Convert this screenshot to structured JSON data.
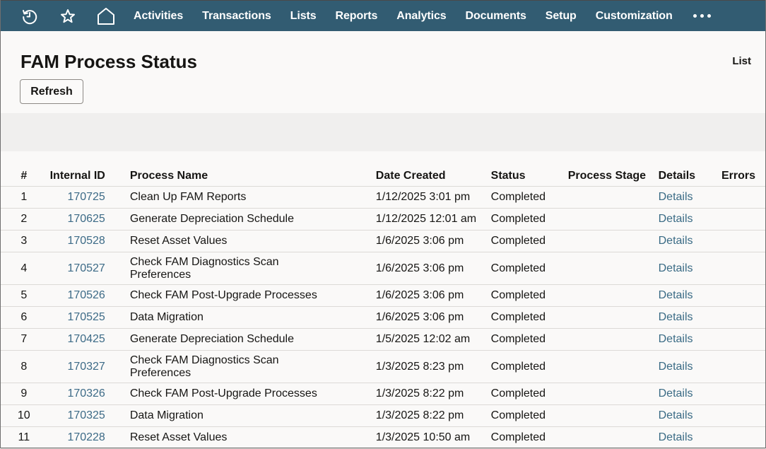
{
  "nav": {
    "icons": [
      "history-icon",
      "star-icon",
      "home-icon"
    ],
    "items": [
      "Activities",
      "Transactions",
      "Lists",
      "Reports",
      "Analytics",
      "Documents",
      "Setup",
      "Customization"
    ],
    "more_icon": "more-horizontal-icon"
  },
  "page": {
    "title": "FAM Process Status",
    "list_link": "List",
    "refresh_label": "Refresh"
  },
  "colors": {
    "nav_bg": "#325c72",
    "link": "#3a6b85",
    "page_bg": "#faf9f8",
    "band_bg": "#f0efee"
  },
  "table": {
    "headers": {
      "num": "#",
      "internal_id": "Internal ID",
      "process_name": "Process Name",
      "date_created": "Date Created",
      "status": "Status",
      "process_stage": "Process Stage",
      "details": "Details",
      "errors": "Errors"
    },
    "rows": [
      {
        "num": "1",
        "id": "170725",
        "name": "Clean Up FAM Reports",
        "date": "1/12/2025 3:01 pm",
        "status": "Completed",
        "stage": "",
        "details": "Details",
        "errors": ""
      },
      {
        "num": "2",
        "id": "170625",
        "name": "Generate Depreciation Schedule",
        "date": "1/12/2025 12:01 am",
        "status": "Completed",
        "stage": "",
        "details": "Details",
        "errors": ""
      },
      {
        "num": "3",
        "id": "170528",
        "name": "Reset Asset Values",
        "date": "1/6/2025 3:06 pm",
        "status": "Completed",
        "stage": "",
        "details": "Details",
        "errors": ""
      },
      {
        "num": "4",
        "id": "170527",
        "name": "Check FAM Diagnostics Scan Preferences",
        "date": "1/6/2025 3:06 pm",
        "status": "Completed",
        "stage": "",
        "details": "Details",
        "errors": ""
      },
      {
        "num": "5",
        "id": "170526",
        "name": "Check FAM Post-Upgrade Processes",
        "date": "1/6/2025 3:06 pm",
        "status": "Completed",
        "stage": "",
        "details": "Details",
        "errors": ""
      },
      {
        "num": "6",
        "id": "170525",
        "name": "Data Migration",
        "date": "1/6/2025 3:06 pm",
        "status": "Completed",
        "stage": "",
        "details": "Details",
        "errors": ""
      },
      {
        "num": "7",
        "id": "170425",
        "name": "Generate Depreciation Schedule",
        "date": "1/5/2025 12:02 am",
        "status": "Completed",
        "stage": "",
        "details": "Details",
        "errors": ""
      },
      {
        "num": "8",
        "id": "170327",
        "name": "Check FAM Diagnostics Scan Preferences",
        "date": "1/3/2025 8:23 pm",
        "status": "Completed",
        "stage": "",
        "details": "Details",
        "errors": ""
      },
      {
        "num": "9",
        "id": "170326",
        "name": "Check FAM Post-Upgrade Processes",
        "date": "1/3/2025 8:22 pm",
        "status": "Completed",
        "stage": "",
        "details": "Details",
        "errors": ""
      },
      {
        "num": "10",
        "id": "170325",
        "name": "Data Migration",
        "date": "1/3/2025 8:22 pm",
        "status": "Completed",
        "stage": "",
        "details": "Details",
        "errors": ""
      },
      {
        "num": "11",
        "id": "170228",
        "name": "Reset Asset Values",
        "date": "1/3/2025 10:50 am",
        "status": "Completed",
        "stage": "",
        "details": "Details",
        "errors": ""
      }
    ]
  }
}
